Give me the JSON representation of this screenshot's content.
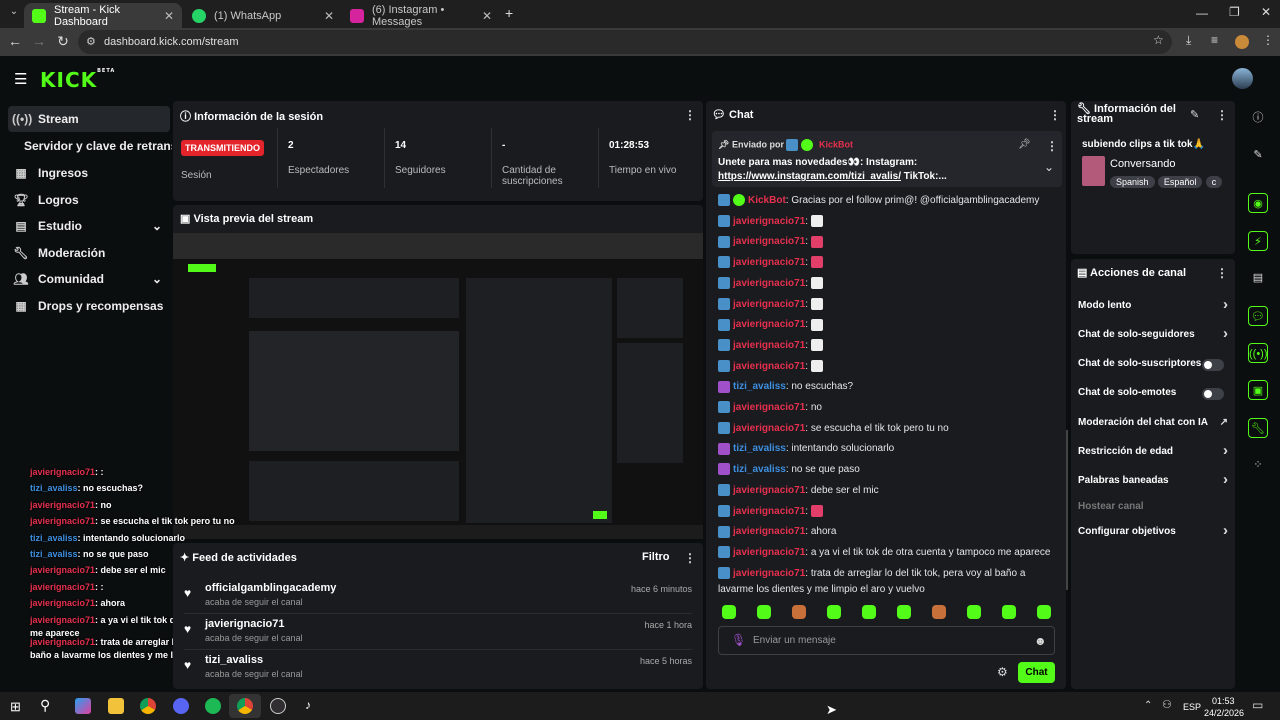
{
  "browser": {
    "tabs": [
      {
        "title": "Stream - Kick Dashboard",
        "active": true
      },
      {
        "title": "(1) WhatsApp",
        "active": false
      },
      {
        "title": "(6) Instagram • Messages",
        "active": false
      }
    ],
    "url": "dashboard.kick.com/stream"
  },
  "sidebar": {
    "items": [
      {
        "label": "Stream"
      },
      {
        "label": "Servidor y clave de retransm"
      },
      {
        "label": "Ingresos"
      },
      {
        "label": "Logros"
      },
      {
        "label": "Estudio"
      },
      {
        "label": "Moderación"
      },
      {
        "label": "Comunidad"
      },
      {
        "label": "Drops y recompensas"
      }
    ]
  },
  "session": {
    "title": "Información de la sesión",
    "live_badge": "TRANSMITIENDO",
    "status_label": "Sesión",
    "viewers": "2",
    "viewers_label": "Espectadores",
    "followers": "14",
    "followers_label": "Seguidores",
    "subs": "-",
    "subs_label": "Cantidad de suscripciones",
    "uptime": "01:28:53",
    "uptime_label": "Tiempo en vivo"
  },
  "preview": {
    "title": "Vista previa del stream"
  },
  "overlay_chat": [
    {
      "user": "javierignacio71",
      "text": ":"
    },
    {
      "user": "tizi_avaliss",
      "text": "no escuchas?"
    },
    {
      "user": "javierignacio71",
      "text": "no"
    },
    {
      "user": "javierignacio71",
      "text": "se escucha el tik tok pero tu no"
    },
    {
      "user": "tizi_avaliss",
      "text": "intentando solucionarlo"
    },
    {
      "user": "tizi_avaliss",
      "text": "no se que paso"
    },
    {
      "user": "javierignacio71",
      "text": "debe ser el mic"
    },
    {
      "user": "javierignacio71",
      "text": ":"
    },
    {
      "user": "javierignacio71",
      "text": "ahora"
    },
    {
      "user": "javierignacio71",
      "text": "a ya vi el tik tok de otra cuenta y tampoco me aparece"
    },
    {
      "user": "javierignacio71",
      "text": "trata de arreglar lo del tik tok, pera voy al baño a lavarme los dientes y me limpio el aro y vuelvo"
    }
  ],
  "feed": {
    "title": "Feed de actividades",
    "filter": "Filtro",
    "items": [
      {
        "name": "officialgamblingacademy",
        "desc": "acaba de seguir el canal",
        "time": "hace 6 minutos"
      },
      {
        "name": "javierignacio71",
        "desc": "acaba de seguir el canal",
        "time": "hace 1 hora"
      },
      {
        "name": "tizi_avaliss",
        "desc": "acaba de seguir el canal",
        "time": "hace 5 horas"
      }
    ]
  },
  "chat": {
    "title": "Chat",
    "pinned_by": "Enviado por",
    "pinned_user": "KickBot",
    "pinned_text": "Unete para mas novedades👀: Instagram:",
    "pinned_link": "https://www.instagram.com/tizi_avalis/",
    "pinned_more": " TikTok:...",
    "messages": [
      {
        "user": "KickBot",
        "text": "Gracias por el follow prim@! @officialgamblingacademy"
      },
      {
        "user": "javierignacio71",
        "text": ""
      },
      {
        "user": "javierignacio71",
        "text": ""
      },
      {
        "user": "javierignacio71",
        "text": ""
      },
      {
        "user": "javierignacio71",
        "text": ""
      },
      {
        "user": "javierignacio71",
        "text": ""
      },
      {
        "user": "javierignacio71",
        "text": ""
      },
      {
        "user": "javierignacio71",
        "text": ""
      },
      {
        "user": "javierignacio71",
        "text": ""
      },
      {
        "user": "tizi_avaliss",
        "text": "no escuchas?"
      },
      {
        "user": "javierignacio71",
        "text": "no"
      },
      {
        "user": "javierignacio71",
        "text": "se escucha el tik tok pero tu no"
      },
      {
        "user": "tizi_avaliss",
        "text": "intentando solucionarlo"
      },
      {
        "user": "tizi_avaliss",
        "text": "no se que paso"
      },
      {
        "user": "javierignacio71",
        "text": "debe ser el mic"
      },
      {
        "user": "javierignacio71",
        "text": ""
      },
      {
        "user": "javierignacio71",
        "text": "ahora"
      },
      {
        "user": "javierignacio71",
        "text": "a ya vi el tik tok de otra cuenta y tampoco me aparece"
      },
      {
        "user": "javierignacio71",
        "text": "trata de arreglar lo del tik tok, pera voy al baño a lavarme los dientes y me limpio el aro y vuelvo"
      }
    ],
    "input_placeholder": "Enviar un mensaje",
    "send_label": "Chat"
  },
  "stream_info": {
    "title": "Información del stream",
    "stream_title": "subiendo clips a tik tok🙏",
    "category": "Conversando",
    "tags": [
      "Spanish",
      "Español",
      "c"
    ]
  },
  "channel_actions": {
    "title": "Acciones de canal",
    "items": [
      {
        "label": "Modo lento",
        "control": "chevron"
      },
      {
        "label": "Chat de solo-seguidores",
        "control": "chevron"
      },
      {
        "label": "Chat de solo-suscriptores",
        "control": "toggle",
        "on": false
      },
      {
        "label": "Chat de solo-emotes",
        "control": "toggle",
        "on": false
      },
      {
        "label": "Moderación del chat con IA",
        "control": "external"
      },
      {
        "label": "Restricción de edad",
        "control": "chevron"
      },
      {
        "label": "Palabras baneadas",
        "control": "chevron"
      },
      {
        "label": "Hostear canal",
        "control": "none"
      },
      {
        "label": "Configurar objetivos",
        "control": "chevron"
      }
    ]
  },
  "taskbar": {
    "lang": "ESP",
    "time": "01:53",
    "date": "24/2/2026"
  },
  "colors": {
    "accent": "#53fc18",
    "live": "#e4242b",
    "username": "#e6304e",
    "username_alt": "#3e8fe0"
  }
}
